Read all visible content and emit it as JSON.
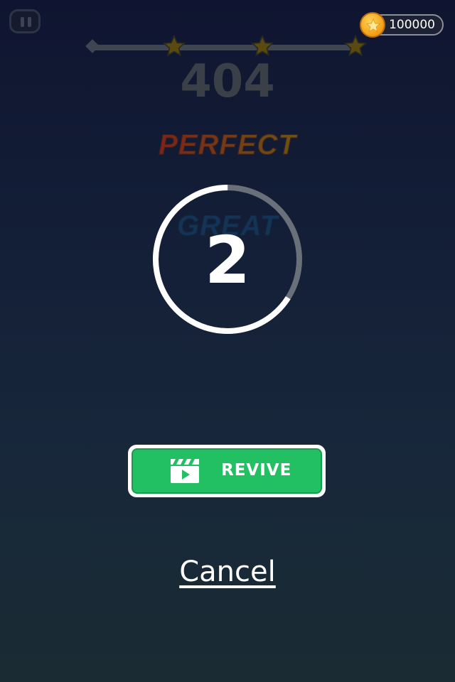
{
  "hud": {
    "coins": "100000",
    "score": "404",
    "stars_earned": 0,
    "stars_total": 3
  },
  "feedback": {
    "perfect_text": "PERFECT",
    "great_text": "GREAT"
  },
  "revive": {
    "countdown": "2",
    "countdown_progress": 0.66,
    "button_label": "REVIVE",
    "cancel_label": "Cancel"
  },
  "colors": {
    "revive_green": "#22bf63",
    "star_empty": "#5a4a10",
    "ring_track": "#6a7079"
  },
  "icons": {
    "pause": "pause-icon",
    "coin": "coin-star-icon",
    "revive": "clapperboard-play-icon"
  }
}
